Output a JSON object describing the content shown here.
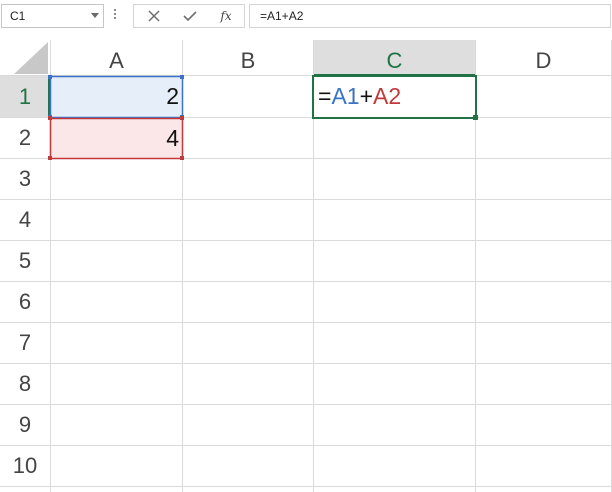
{
  "formula_bar": {
    "name_box": "C1",
    "formula": "=A1+A2",
    "cancel_icon": "close-icon",
    "enter_icon": "check-icon",
    "function_label": "fx"
  },
  "columns": [
    "A",
    "B",
    "C",
    "D"
  ],
  "rows": [
    "1",
    "2",
    "3",
    "4",
    "5",
    "6",
    "7",
    "8",
    "9",
    "10"
  ],
  "cells": {
    "A1": "2",
    "A2": "4",
    "C1": {
      "prefix": "=",
      "ref1": "A1",
      "operator": "+",
      "ref2": "A2"
    }
  },
  "colors": {
    "grid": "#dadada",
    "header_bg": "#f3f3f3",
    "selected_header_bg": "#dedede",
    "selected_header_text": "#217346",
    "active_border": "#217346",
    "ref1": "#3b73c6",
    "ref1_fill": "#e6eefa",
    "ref2": "#c0393b",
    "ref2_fill": "#fbe7e7"
  }
}
